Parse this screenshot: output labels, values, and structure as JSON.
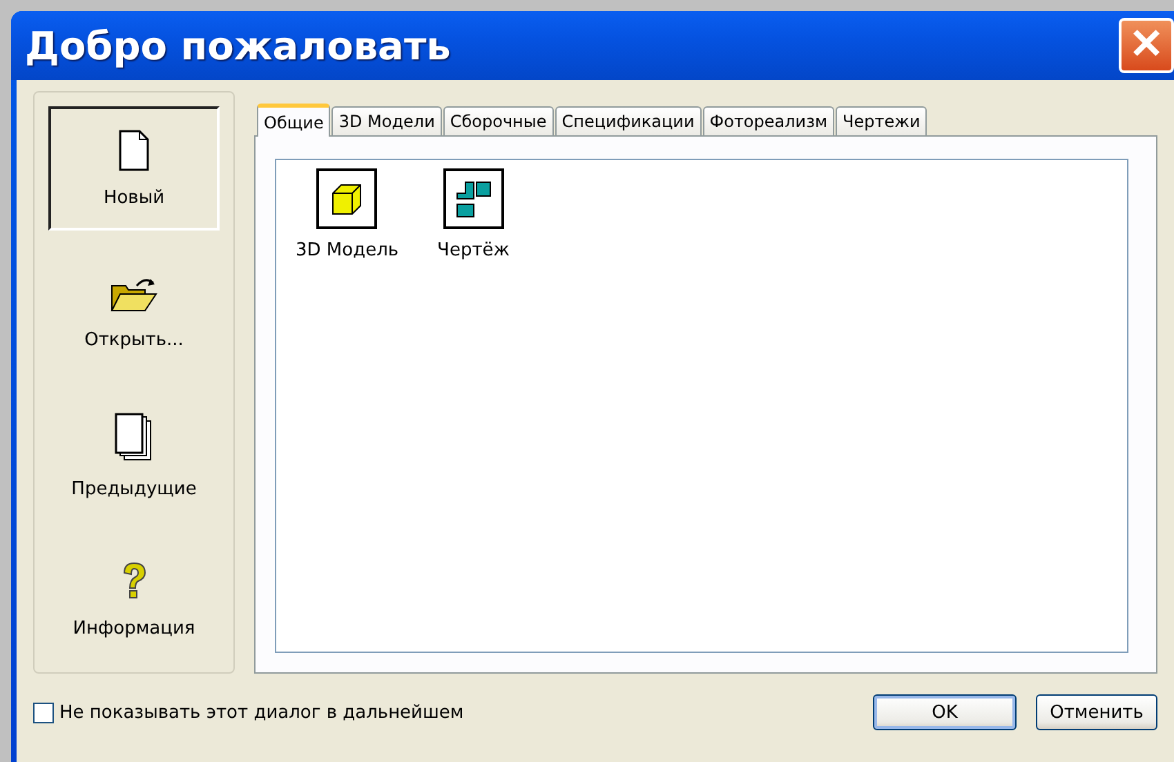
{
  "window": {
    "title": "Добро пожаловать",
    "close": "✕"
  },
  "sidebar": {
    "items": [
      {
        "label": "Новый",
        "kind": "new",
        "selected": true
      },
      {
        "label": "Открыть...",
        "kind": "open",
        "selected": false
      },
      {
        "label": "Предыдущие",
        "kind": "recent",
        "selected": false
      },
      {
        "label": "Информация",
        "kind": "info",
        "selected": false
      }
    ]
  },
  "tabs": [
    {
      "label": "Общие",
      "selected": true
    },
    {
      "label": "3D Модели",
      "selected": false
    },
    {
      "label": "Сборочные",
      "selected": false
    },
    {
      "label": "Спецификации",
      "selected": false
    },
    {
      "label": "Фотореализм",
      "selected": false
    },
    {
      "label": "Чертежи",
      "selected": false
    }
  ],
  "templates": [
    {
      "label": "3D Модель",
      "kind": "model"
    },
    {
      "label": "Чертёж",
      "kind": "drawing"
    }
  ],
  "dont_show": {
    "label": "Не показывать этот диалог в дальнейшем",
    "checked": false
  },
  "buttons": [
    {
      "label": "OK",
      "kind": "default"
    },
    {
      "label": "Отменить",
      "kind": "normal"
    }
  ]
}
